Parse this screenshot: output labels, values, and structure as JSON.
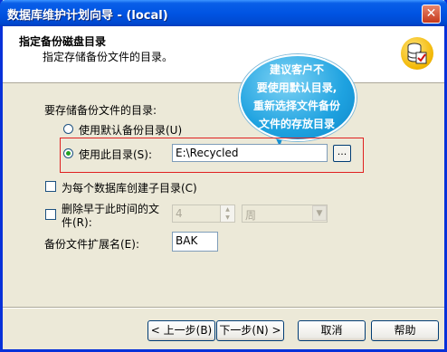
{
  "window": {
    "title": "数据库维护计划向导 - (local)",
    "close_symbol": "✕"
  },
  "header": {
    "title": "指定备份磁盘目录",
    "subtitle": "指定存储备份文件的目录。"
  },
  "annotation": {
    "lines": [
      "建议客户不",
      "要使用默认目录,",
      "重新选择文件备份",
      "文件的存放目录"
    ]
  },
  "directory_group": {
    "label": "要存储备份文件的目录:",
    "option_default": "使用默认备份目录(U)",
    "option_custom": "使用此目录(S):",
    "selected": "custom",
    "path_value": "E:\\Recycled",
    "browse_label": "..."
  },
  "subdir": {
    "label": "为每个数据库创建子目录(C)",
    "checked": false
  },
  "delete_older": {
    "label_line1": "删除早于此时间的文",
    "label_line2": "件(R):",
    "checked": false,
    "number_value": "4",
    "unit_value": "周"
  },
  "extension": {
    "label": "备份文件扩展名(E):",
    "value": "BAK"
  },
  "buttons": {
    "back": "< 上一步(B)",
    "next": "下一步(N) >",
    "cancel": "取消",
    "help": "帮助"
  }
}
